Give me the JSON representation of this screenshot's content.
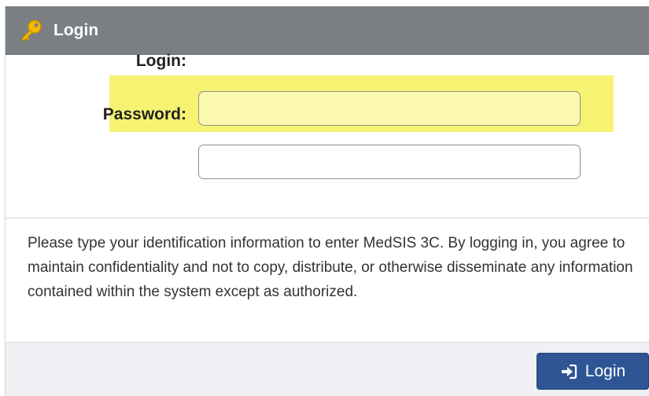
{
  "header": {
    "title": "Login",
    "icon": "key-icon",
    "background_color": "#7a7f84"
  },
  "form": {
    "login_label": "Login:",
    "login_value": "",
    "password_label": "Password:",
    "password_value": "",
    "highlight_color": "#f6f372"
  },
  "notice": {
    "text": "Please type your identification information to enter MedSIS 3C. By logging in, you agree to maintain confidentiality and not to copy, distribute, or otherwise disseminate any information contained within the system except as authorized."
  },
  "footer": {
    "login_button_label": "Login",
    "login_button_icon": "sign-in-icon",
    "button_color": "#2f5595"
  }
}
